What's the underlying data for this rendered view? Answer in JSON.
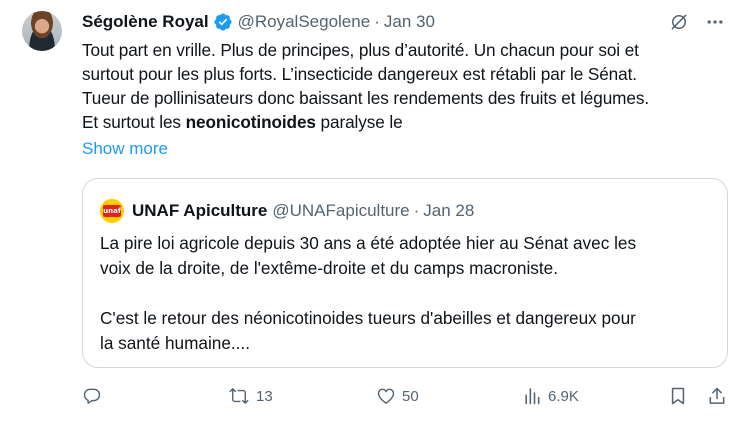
{
  "author": {
    "name": "Ségolène Royal",
    "handle": "@RoyalSegolene",
    "date": "Jan 30",
    "verified_color": "#1d9bf0"
  },
  "post": {
    "lines": [
      "Tout part en vrille. Plus de principes, plus d’autorité. Un chacun pour soi et",
      "surtout pour les plus forts. L’insecticide dangereux est rétabli par le Sénat.",
      "Tueur de pollinisateurs donc baissant les rendements des fruits et légumes."
    ],
    "last_line_before": "Et surtout les ",
    "last_line_bold": "neonicotinoides",
    "last_line_after": " paralyse le",
    "show_more": "Show more"
  },
  "quote": {
    "name": "UNAF Apiculture",
    "handle": "@UNAFapiculture",
    "date": "Jan 28",
    "logo_text": "unaf",
    "lines": [
      "La pire loi agricole depuis 30 ans a été adoptée hier au Sénat avec les",
      "voix de la droite, de l'extême-droite et du camps macroniste.",
      "C'est le retour des néonicotinoides tueurs d'abeilles et dangereux pour",
      "la santé humaine...."
    ]
  },
  "actions": {
    "reply_icon": "reply-icon",
    "repost_count": "13",
    "like_count": "50",
    "views_count": "6.9K",
    "bookmark_icon": "bookmark-icon",
    "share_icon": "share-icon"
  },
  "colors": {
    "accent": "#1d9bf0",
    "secondary_text": "#536471",
    "border": "#cfd9de"
  }
}
